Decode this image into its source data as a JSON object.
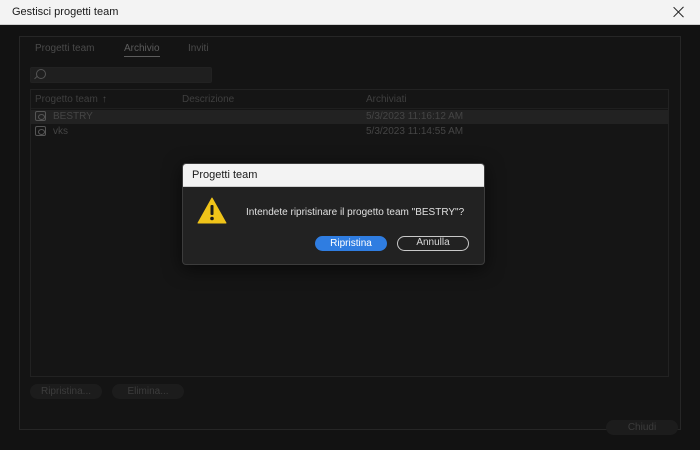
{
  "window": {
    "title": "Gestisci progetti team"
  },
  "tabs": [
    {
      "label": "Progetti team"
    },
    {
      "label": "Archivio"
    },
    {
      "label": "Inviti"
    }
  ],
  "active_tab": "Archivio",
  "search": {
    "value": ""
  },
  "table": {
    "columns": [
      "Progetto team",
      "Descrizione",
      "Archiviati"
    ],
    "rows": [
      {
        "name": "BESTRY",
        "description": "",
        "archived": "5/3/2023 11:16:12 AM"
      },
      {
        "name": "vks",
        "description": "",
        "archived": "5/3/2023 11:14:55 AM"
      }
    ]
  },
  "buttons": {
    "restore": "Ripristina...",
    "delete": "Elimina...",
    "close": "Chiudi"
  },
  "dialog": {
    "title": "Progetti team",
    "message": "Intendete ripristinare il progetto team \"BESTRY\"?",
    "primary": "Ripristina",
    "secondary": "Annulla",
    "icon": "warning-icon"
  },
  "colors": {
    "accent": "#2f7de1",
    "warning": "#f0c419"
  }
}
